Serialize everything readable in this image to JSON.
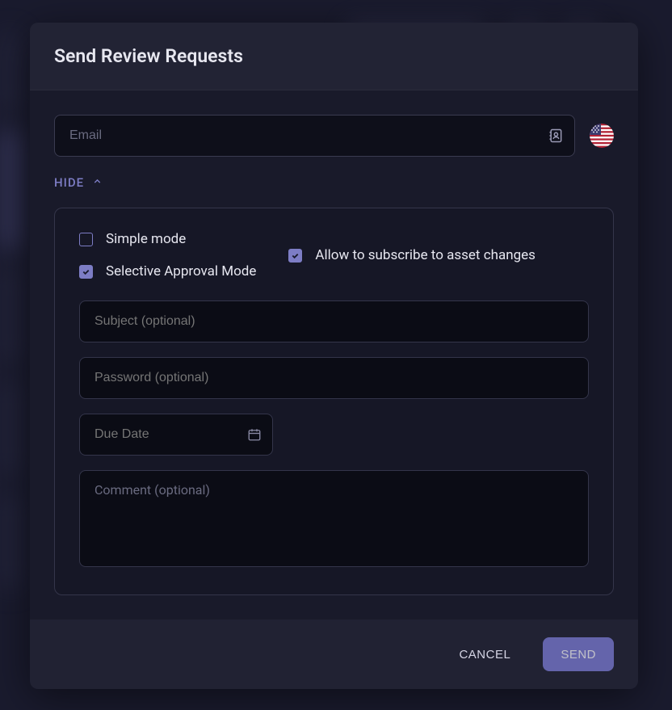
{
  "modal": {
    "title": "Send Review Requests",
    "email_placeholder": "Email",
    "hide_label": "HIDE",
    "options": {
      "simple_mode": {
        "label": "Simple mode",
        "checked": false
      },
      "selective_approval": {
        "label": "Selective Approval Mode",
        "checked": true
      },
      "allow_subscribe": {
        "label": "Allow to subscribe to asset changes",
        "checked": true
      }
    },
    "subject_placeholder": "Subject (optional)",
    "password_placeholder": "Password (optional)",
    "due_date_placeholder": "Due Date",
    "comment_placeholder": "Comment (optional)",
    "cancel_label": "CANCEL",
    "send_label": "SEND",
    "flag": "us"
  }
}
